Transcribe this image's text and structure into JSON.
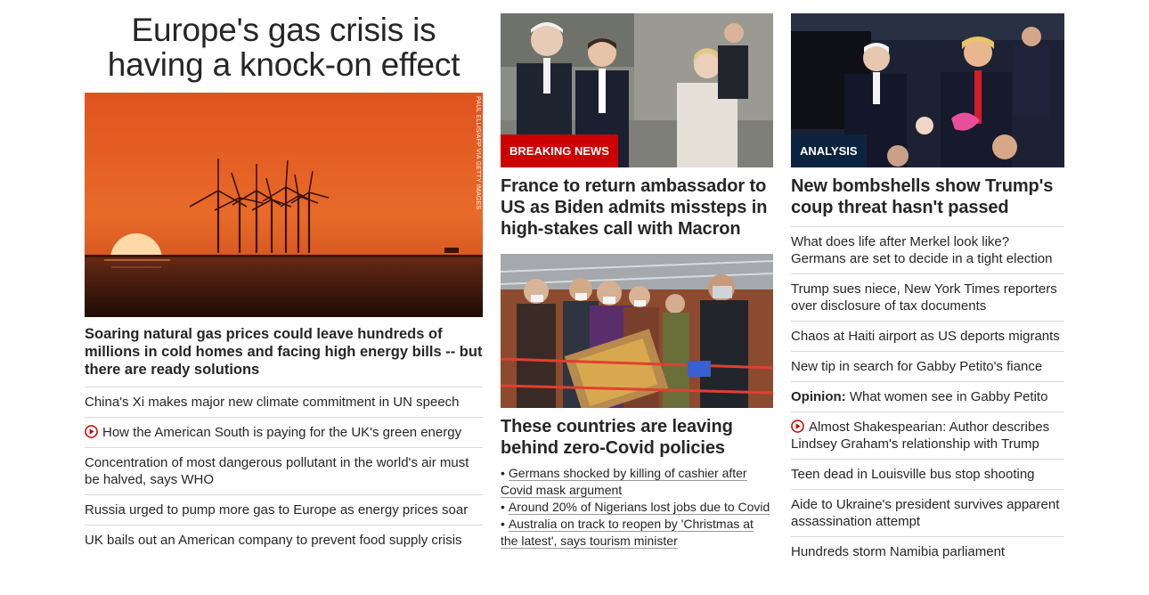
{
  "col1": {
    "headline": "Europe's gas crisis is having a knock-on effect",
    "image": {
      "alt": "Wind turbines at sunset over the sea",
      "credit": "PAUL ELLIS/AFP VIA GETTY IMAGES"
    },
    "feature_link": "Soaring natural gas prices could leave hundreds of millions in cold homes and facing high energy bills -- but there are ready solutions",
    "links": [
      {
        "text": "China's Xi makes major new climate commitment in UN speech",
        "video": false
      },
      {
        "text": "How the American South is paying for the UK's green energy",
        "video": true
      },
      {
        "text": "Concentration of most dangerous pollutant in the world's air must be halved, says WHO",
        "video": false
      },
      {
        "text": "Russia urged to pump more gas to Europe as energy prices soar",
        "video": false
      },
      {
        "text": "UK bails out an American company to prevent food supply crisis",
        "video": false
      }
    ]
  },
  "col2": {
    "story1": {
      "badge": "BREAKING NEWS",
      "image_alt": "Biden, Macron and von der Leyen walking",
      "headline": "France to return ambassador to US as Biden admits missteps in high-stakes call with Macron"
    },
    "story2": {
      "image_alt": "Passengers in masks at an airport",
      "headline": "These countries are leaving behind zero-Covid policies",
      "bullets": [
        "Germans shocked by killing of cashier after Covid mask argument",
        "Around 20% of Nigerians lost jobs due to Covid",
        "Australia on track to reopen by 'Christmas at the latest', says tourism minister"
      ],
      "bullet_char": "•"
    }
  },
  "col3": {
    "story": {
      "badge": "ANALYSIS",
      "image_alt": "Pence and Trump applauding at a rally",
      "headline": "New bombshells show Trump's coup threat hasn't passed"
    },
    "links": [
      {
        "text": "What does life after Merkel look like? Germans are set to decide in a tight election",
        "video": false,
        "prefix": ""
      },
      {
        "text": "Trump sues niece, New York Times reporters over disclosure of tax documents",
        "video": false,
        "prefix": ""
      },
      {
        "text": "Chaos at Haiti airport as US deports migrants",
        "video": false,
        "prefix": ""
      },
      {
        "text": "New tip in search for Gabby Petito's fiance",
        "video": false,
        "prefix": ""
      },
      {
        "text": "What women see in Gabby Petito",
        "video": false,
        "prefix": "Opinion:"
      },
      {
        "text": "Almost Shakespearian: Author describes Lindsey Graham's relationship with Trump",
        "video": true,
        "prefix": ""
      },
      {
        "text": "Teen dead in Louisville bus stop shooting",
        "video": false,
        "prefix": ""
      },
      {
        "text": "Aide to Ukraine's president survives apparent assassination attempt",
        "video": false,
        "prefix": ""
      },
      {
        "text": "Hundreds storm Namibia parliament",
        "video": false,
        "prefix": ""
      }
    ]
  },
  "colors": {
    "breaking": "#cc0000",
    "analysis": "#0c2340",
    "play": "#cc0000",
    "divider": "#d9d9d9",
    "text": "#262626"
  },
  "icons": {
    "video": "play-circle-icon"
  }
}
